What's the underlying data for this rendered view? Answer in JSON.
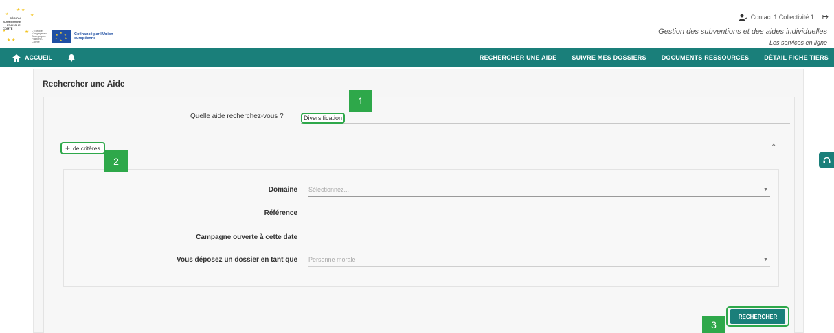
{
  "header": {
    "logo_text": [
      "RÉGION",
      "BOURGOGNE",
      "FRANCHE",
      "COMTÉ"
    ],
    "eu_small_text": "L'Europe s'engage en Bourgogne-Franche-Comté",
    "eu_cofinance": "Cofinancé par l'Union européenne",
    "user_label": "Contact 1 Collectivité 1",
    "subtitle": "Gestion des subventions et des aides individuelles",
    "tagline": "Les services en ligne"
  },
  "nav": {
    "home_label": "ACCUEIL",
    "links": [
      "RECHERCHER UNE AIDE",
      "SUIVRE MES DOSSIERS",
      "DOCUMENTS RESSOURCES",
      "DÉTAIL FICHE TIERS"
    ]
  },
  "main": {
    "page_title": "Rechercher une Aide",
    "question_label": "Quelle aide recherchez-vous ?",
    "question_value": "Diversification",
    "criteria_toggle_label": "de critères",
    "criteria": {
      "domaine_label": "Domaine",
      "domaine_placeholder": "Sélectionnez...",
      "reference_label": "Référence",
      "campagne_label": "Campagne ouverte à cette date",
      "depot_label": "Vous déposez un dossier en tant que",
      "depot_value": "Personne morale"
    },
    "search_button": "RECHERCHER"
  },
  "annotations": [
    "1",
    "2",
    "3"
  ],
  "colors": {
    "primary": "#1a7f7a",
    "annotation": "#2ea84a"
  }
}
